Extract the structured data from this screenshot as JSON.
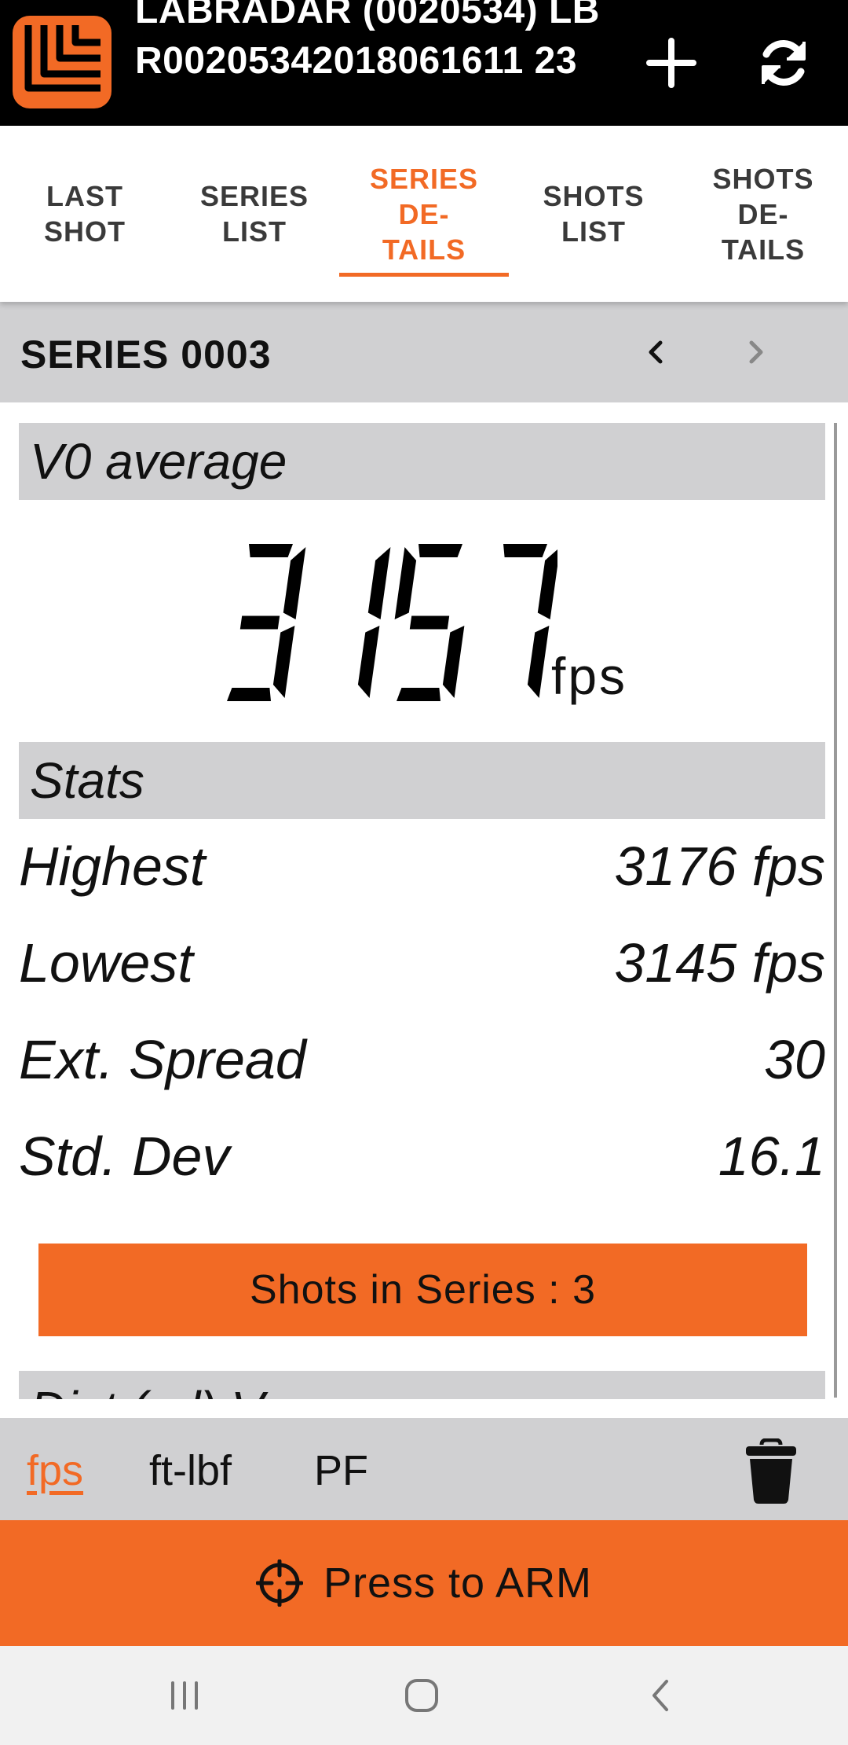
{
  "header": {
    "device_title": "LABRADAR (0020534) LBR00205342018061611 23"
  },
  "tabs": [
    {
      "label": "LAST\nSHOT",
      "active": false
    },
    {
      "label": "SERIES\nLIST",
      "active": false
    },
    {
      "label": "SERIES\nDE-\nTAILS",
      "active": true
    },
    {
      "label": "SHOTS\nLIST",
      "active": false
    },
    {
      "label": "SHOTS\nDE-\nTAILS",
      "active": false
    }
  ],
  "series": {
    "title": "SERIES 0003"
  },
  "v0": {
    "header": "V0 average",
    "value": "3157",
    "unit": "fps"
  },
  "stats": {
    "header": "Stats",
    "rows": [
      {
        "label": "Highest",
        "value": "3176 fps"
      },
      {
        "label": "Lowest",
        "value": "3145 fps"
      },
      {
        "label": "Ext. Spread",
        "value": "30"
      },
      {
        "label": "Std. Dev",
        "value": "16.1"
      }
    ]
  },
  "shots_button": "Shots in Series : 3",
  "dist_header": "Dist (yd) V",
  "units": [
    {
      "label": "fps",
      "active": true
    },
    {
      "label": "ft-lbf",
      "active": false
    },
    {
      "label": "PF",
      "active": false
    }
  ],
  "arm": {
    "label": "Press to ARM"
  },
  "colors": {
    "accent": "#f26a25",
    "header_bg": "#000000",
    "section_bg": "#d0d0d2"
  },
  "icons": [
    "labradar-logo-icon",
    "plus-icon",
    "refresh-icon",
    "chevron-left-icon",
    "chevron-right-icon",
    "trash-icon",
    "crosshair-icon",
    "recent-apps-icon",
    "home-icon",
    "back-icon"
  ]
}
